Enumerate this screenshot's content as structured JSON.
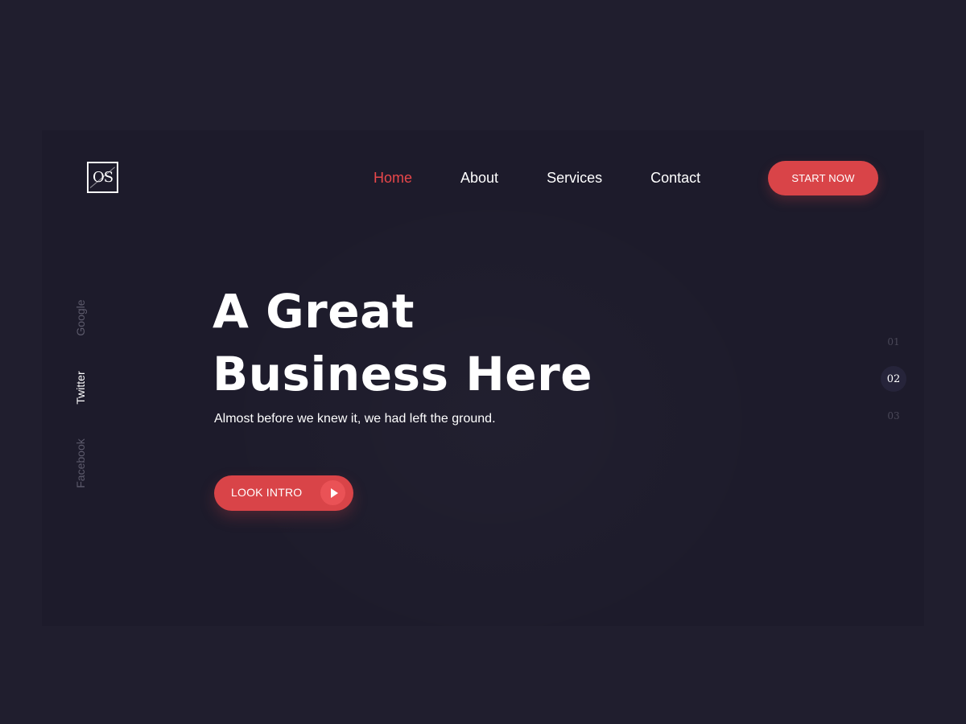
{
  "logo": {
    "text": "OS"
  },
  "nav": {
    "items": [
      {
        "label": "Home",
        "active": true
      },
      {
        "label": "About",
        "active": false
      },
      {
        "label": "Services",
        "active": false
      },
      {
        "label": "Contact",
        "active": false
      }
    ],
    "cta_label": "START NOW"
  },
  "social": {
    "items": [
      {
        "label": "Google",
        "active": false
      },
      {
        "label": "Twitter",
        "active": true
      },
      {
        "label": "Facebook",
        "active": false
      }
    ]
  },
  "hero": {
    "title_line1": "A Great",
    "title_line2": "Business Here",
    "subtitle": "Almost before we knew it, we had left the ground.",
    "cta_label": "LOOK INTRO",
    "cta_icon": "play-icon"
  },
  "pagination": {
    "items": [
      "01",
      "02",
      "03"
    ],
    "active_index": 1
  },
  "colors": {
    "background": "#201e2e",
    "panel": "#1d1b2b",
    "accent": "#d94448",
    "text": "#ffffff",
    "muted": "#5d5b6c"
  }
}
